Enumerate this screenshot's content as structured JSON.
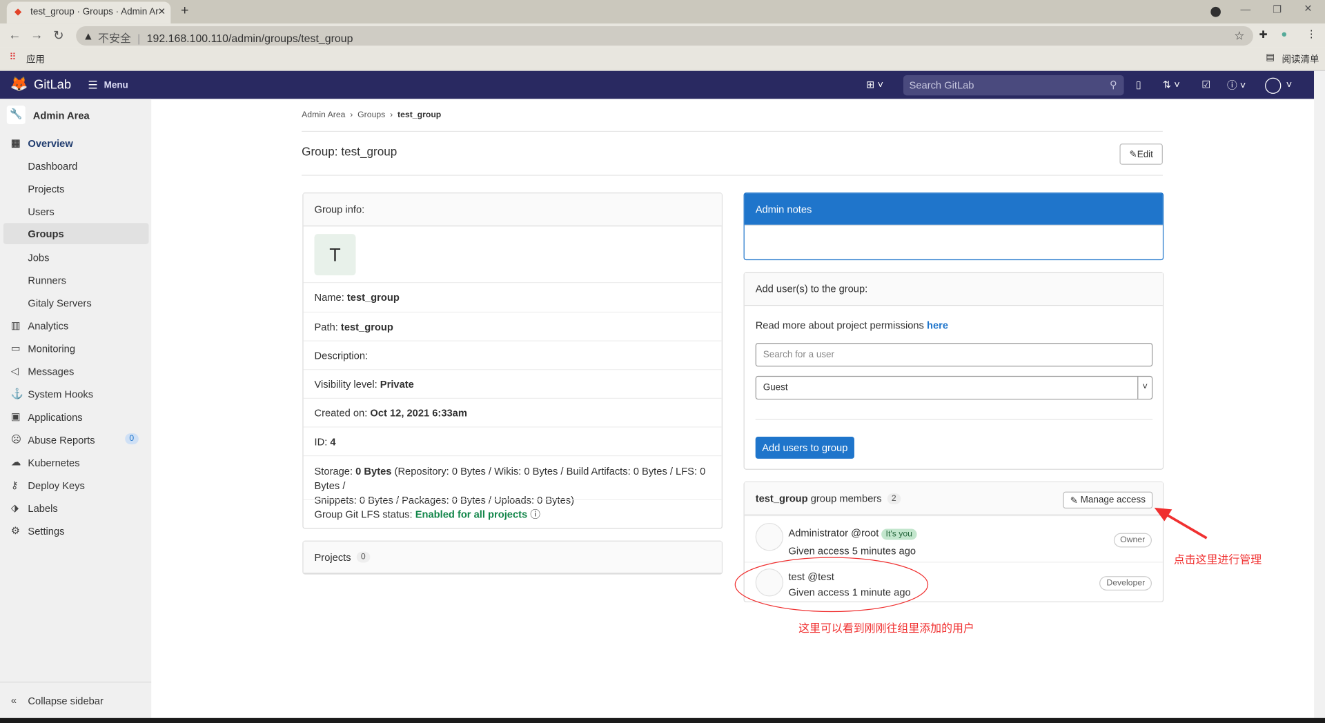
{
  "browser": {
    "tab_title": "test_group · Groups · Admin Ar",
    "new_tab": "+",
    "security": "不安全",
    "url": "192.168.100.110/admin/groups/test_group",
    "bookmark_apps": "应用",
    "reading_list": "阅读清单"
  },
  "header": {
    "brand": "GitLab",
    "menu": "Menu",
    "search_placeholder": "Search GitLab"
  },
  "sidebar": {
    "title": "Admin Area",
    "items": [
      {
        "label": "Overview",
        "icon": "grid-icon"
      },
      {
        "label": "Dashboard"
      },
      {
        "label": "Projects"
      },
      {
        "label": "Users"
      },
      {
        "label": "Groups"
      },
      {
        "label": "Jobs"
      },
      {
        "label": "Runners"
      },
      {
        "label": "Gitaly Servers"
      },
      {
        "label": "Analytics",
        "icon": "chart-icon"
      },
      {
        "label": "Monitoring",
        "icon": "monitor-icon"
      },
      {
        "label": "Messages",
        "icon": "bullhorn-icon"
      },
      {
        "label": "System Hooks",
        "icon": "hook-icon"
      },
      {
        "label": "Applications",
        "icon": "apps-icon"
      },
      {
        "label": "Abuse Reports",
        "icon": "abuse-icon",
        "count": "0"
      },
      {
        "label": "Kubernetes",
        "icon": "cloud-icon"
      },
      {
        "label": "Deploy Keys",
        "icon": "key-icon"
      },
      {
        "label": "Labels",
        "icon": "label-icon"
      },
      {
        "label": "Settings",
        "icon": "gear-icon"
      }
    ],
    "collapse": "Collapse sidebar"
  },
  "breadcrumb": [
    "Admin Area",
    "Groups",
    "test_group"
  ],
  "page": {
    "title": "Group: test_group",
    "edit": "Edit"
  },
  "group_info": {
    "header": "Group info:",
    "avatar_letter": "T",
    "name_label": "Name:",
    "name": "test_group",
    "path_label": "Path:",
    "path": "test_group",
    "description_label": "Description:",
    "visibility_label": "Visibility level:",
    "visibility": "Private",
    "created_label": "Created on:",
    "created": "Oct 12, 2021 6:33am",
    "id_label": "ID:",
    "id": "4",
    "storage_label": "Storage:",
    "storage": "0 Bytes",
    "storage_detail_1": "(Repository: 0 Bytes / Wikis: 0 Bytes / Build Artifacts: 0 Bytes / LFS: 0 Bytes /",
    "storage_detail_2": "Snippets: 0 Bytes / Packages: 0 Bytes / Uploads: 0 Bytes)",
    "lfs_label": "Group Git LFS status:",
    "lfs": "Enabled for all projects"
  },
  "projects": {
    "label": "Projects",
    "count": "0"
  },
  "admin_notes": {
    "header": "Admin notes"
  },
  "add_users": {
    "header": "Add user(s) to the group:",
    "info": "Read more about project permissions",
    "link": "here",
    "search_placeholder": "Search for a user",
    "role": "Guest",
    "button": "Add users to group"
  },
  "members": {
    "group": "test_group",
    "label": "group members",
    "count": "2",
    "manage": "Manage access",
    "list": [
      {
        "name": "Administrator",
        "handle": "@root",
        "tag": "It's you",
        "given": "Given access 5 minutes ago",
        "role": "Owner"
      },
      {
        "name": "test",
        "handle": "@test",
        "given": "Given access 1 minute ago",
        "role": "Developer"
      }
    ]
  },
  "annotations": {
    "arrow_note": "点击这里进行管理",
    "circle_note": "这里可以看到刚刚往组里添加的用户"
  },
  "colors": {
    "header": "#292961",
    "primary": "#1f75cb",
    "success": "#108548",
    "annotation": "#f03030"
  }
}
